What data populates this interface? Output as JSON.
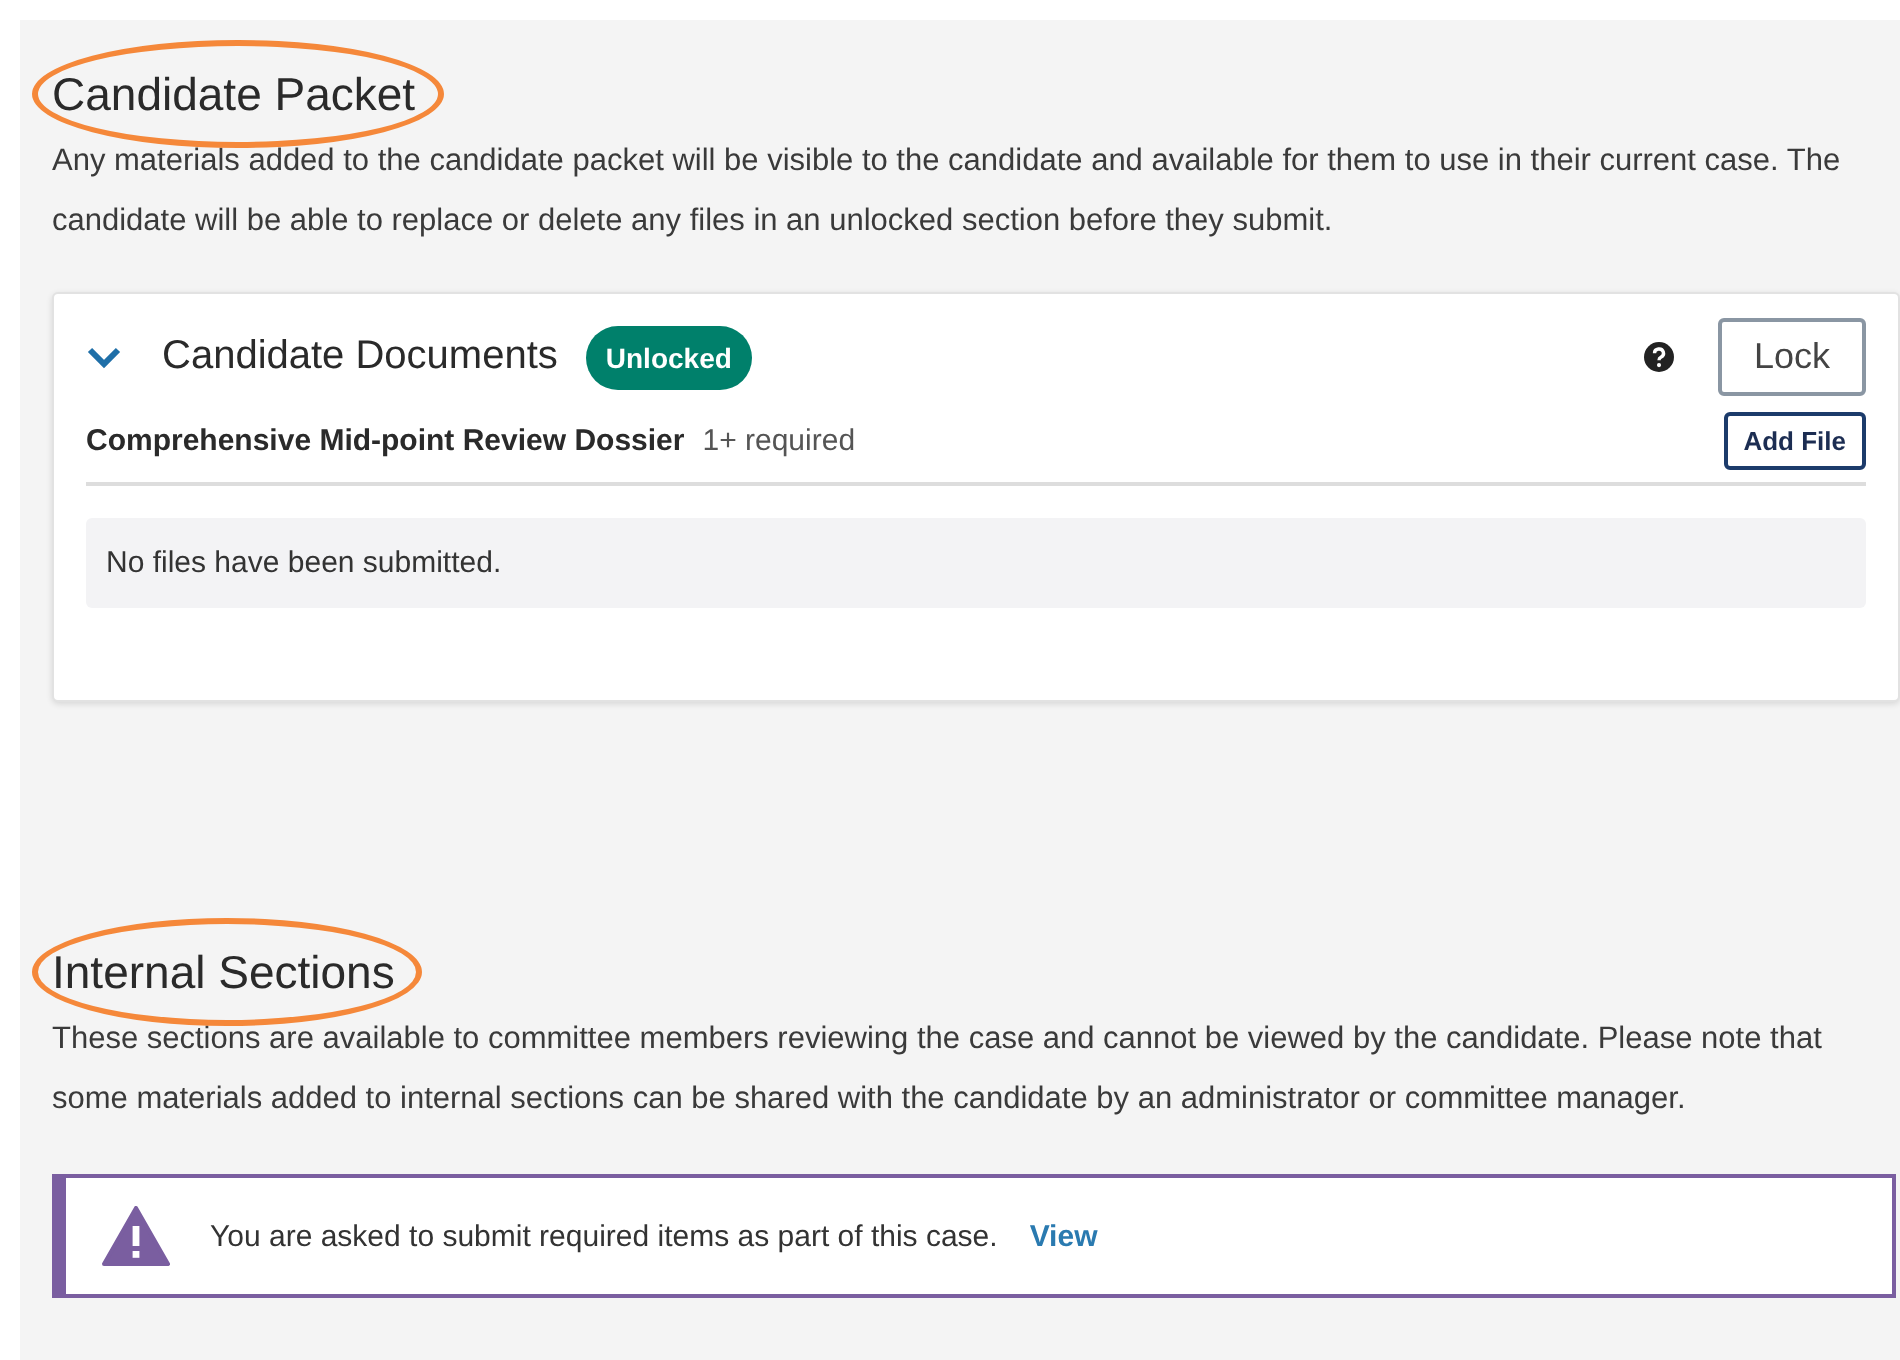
{
  "sections": [
    {
      "kind": "packet",
      "title": "Candidate Packet",
      "circled": true,
      "description": "Any materials added to the candidate packet will be visible to the candidate and available for them to use in their current case. The candidate will be able to replace or delete any files in an unlocked section before they submit.",
      "card": {
        "title": "Candidate Documents",
        "expanded": true,
        "status": "Unlocked",
        "locked": false,
        "lock_button": "Lock",
        "requirement": {
          "name": "Comprehensive Mid-point Review Dossier",
          "count": "1+ required",
          "button": "Add File"
        },
        "empty_message": "No files have been submitted."
      }
    },
    {
      "kind": "internal",
      "title": "Internal Sections",
      "circled": true,
      "description": "These sections are available to committee members reviewing the case and cannot be viewed by the candidate. Please note that some materials added to internal sections can be shared with the candidate by an administrator or committee manager.",
      "alert": {
        "message": "You are asked to submit required items as part of this case.",
        "link": "View"
      }
    }
  ]
}
